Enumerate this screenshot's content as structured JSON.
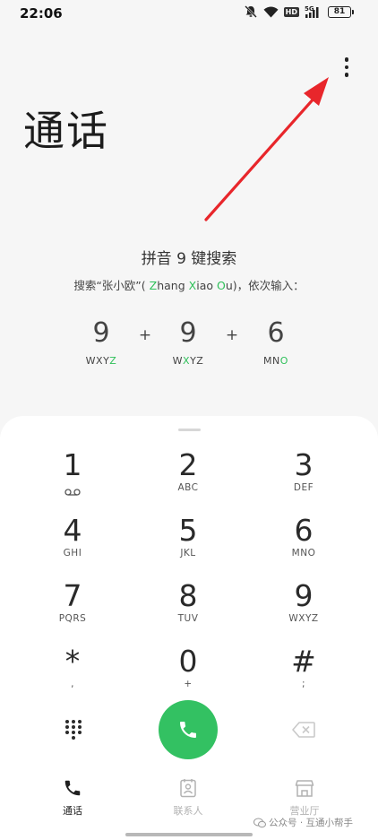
{
  "status_bar": {
    "time": "22:06",
    "hd": "HD",
    "net": "5G",
    "battery": "81",
    "icons": [
      "mute-icon",
      "wifi-icon",
      "signal-icon",
      "battery-icon"
    ]
  },
  "header": {
    "title": "通话",
    "menu_icon": "more-vertical-icon"
  },
  "pinyin_hint": {
    "title": "拼音 9 键搜索",
    "desc_prefix": "搜索“张小欧”( ",
    "desc_z": "Z",
    "desc_hang": "hang ",
    "desc_x": "X",
    "desc_iao": "iao ",
    "desc_o": "O",
    "desc_u": "u",
    "desc_suffix": ")，依次输入：",
    "plus": "+",
    "examples": [
      {
        "digit": "9",
        "letters_plain": "WXY",
        "letters_green": "Z",
        "letters_tail": ""
      },
      {
        "digit": "9",
        "letters_plain": "W",
        "letters_green": "X",
        "letters_tail": "YZ"
      },
      {
        "digit": "6",
        "letters_plain": "MN",
        "letters_green": "O",
        "letters_tail": ""
      }
    ]
  },
  "dialpad": {
    "keys": [
      {
        "digit": "1",
        "letters": ""
      },
      {
        "digit": "2",
        "letters": "ABC"
      },
      {
        "digit": "3",
        "letters": "DEF"
      },
      {
        "digit": "4",
        "letters": "GHI"
      },
      {
        "digit": "5",
        "letters": "JKL"
      },
      {
        "digit": "6",
        "letters": "MNO"
      },
      {
        "digit": "7",
        "letters": "PQRS"
      },
      {
        "digit": "8",
        "letters": "TUV"
      },
      {
        "digit": "9",
        "letters": "WXYZ"
      },
      {
        "digit": "*",
        "letters": ","
      },
      {
        "digit": "0",
        "letters": "+"
      },
      {
        "digit": "#",
        "letters": ";"
      }
    ],
    "key1_icon": "voicemail-icon",
    "call_icon": "phone-icon",
    "call_color": "#33c162"
  },
  "bottom_nav": {
    "items": [
      {
        "label": "通话",
        "icon": "phone-icon",
        "active": true
      },
      {
        "label": "联系人",
        "icon": "contacts-icon",
        "active": false
      },
      {
        "label": "营业厅",
        "icon": "store-icon",
        "active": false
      }
    ]
  },
  "watermark": {
    "text": "公众号 · 互通小帮手"
  },
  "colors": {
    "accent_green": "#2fc05a",
    "arrow_red": "#e8262b",
    "background": "#f6f6f6"
  }
}
